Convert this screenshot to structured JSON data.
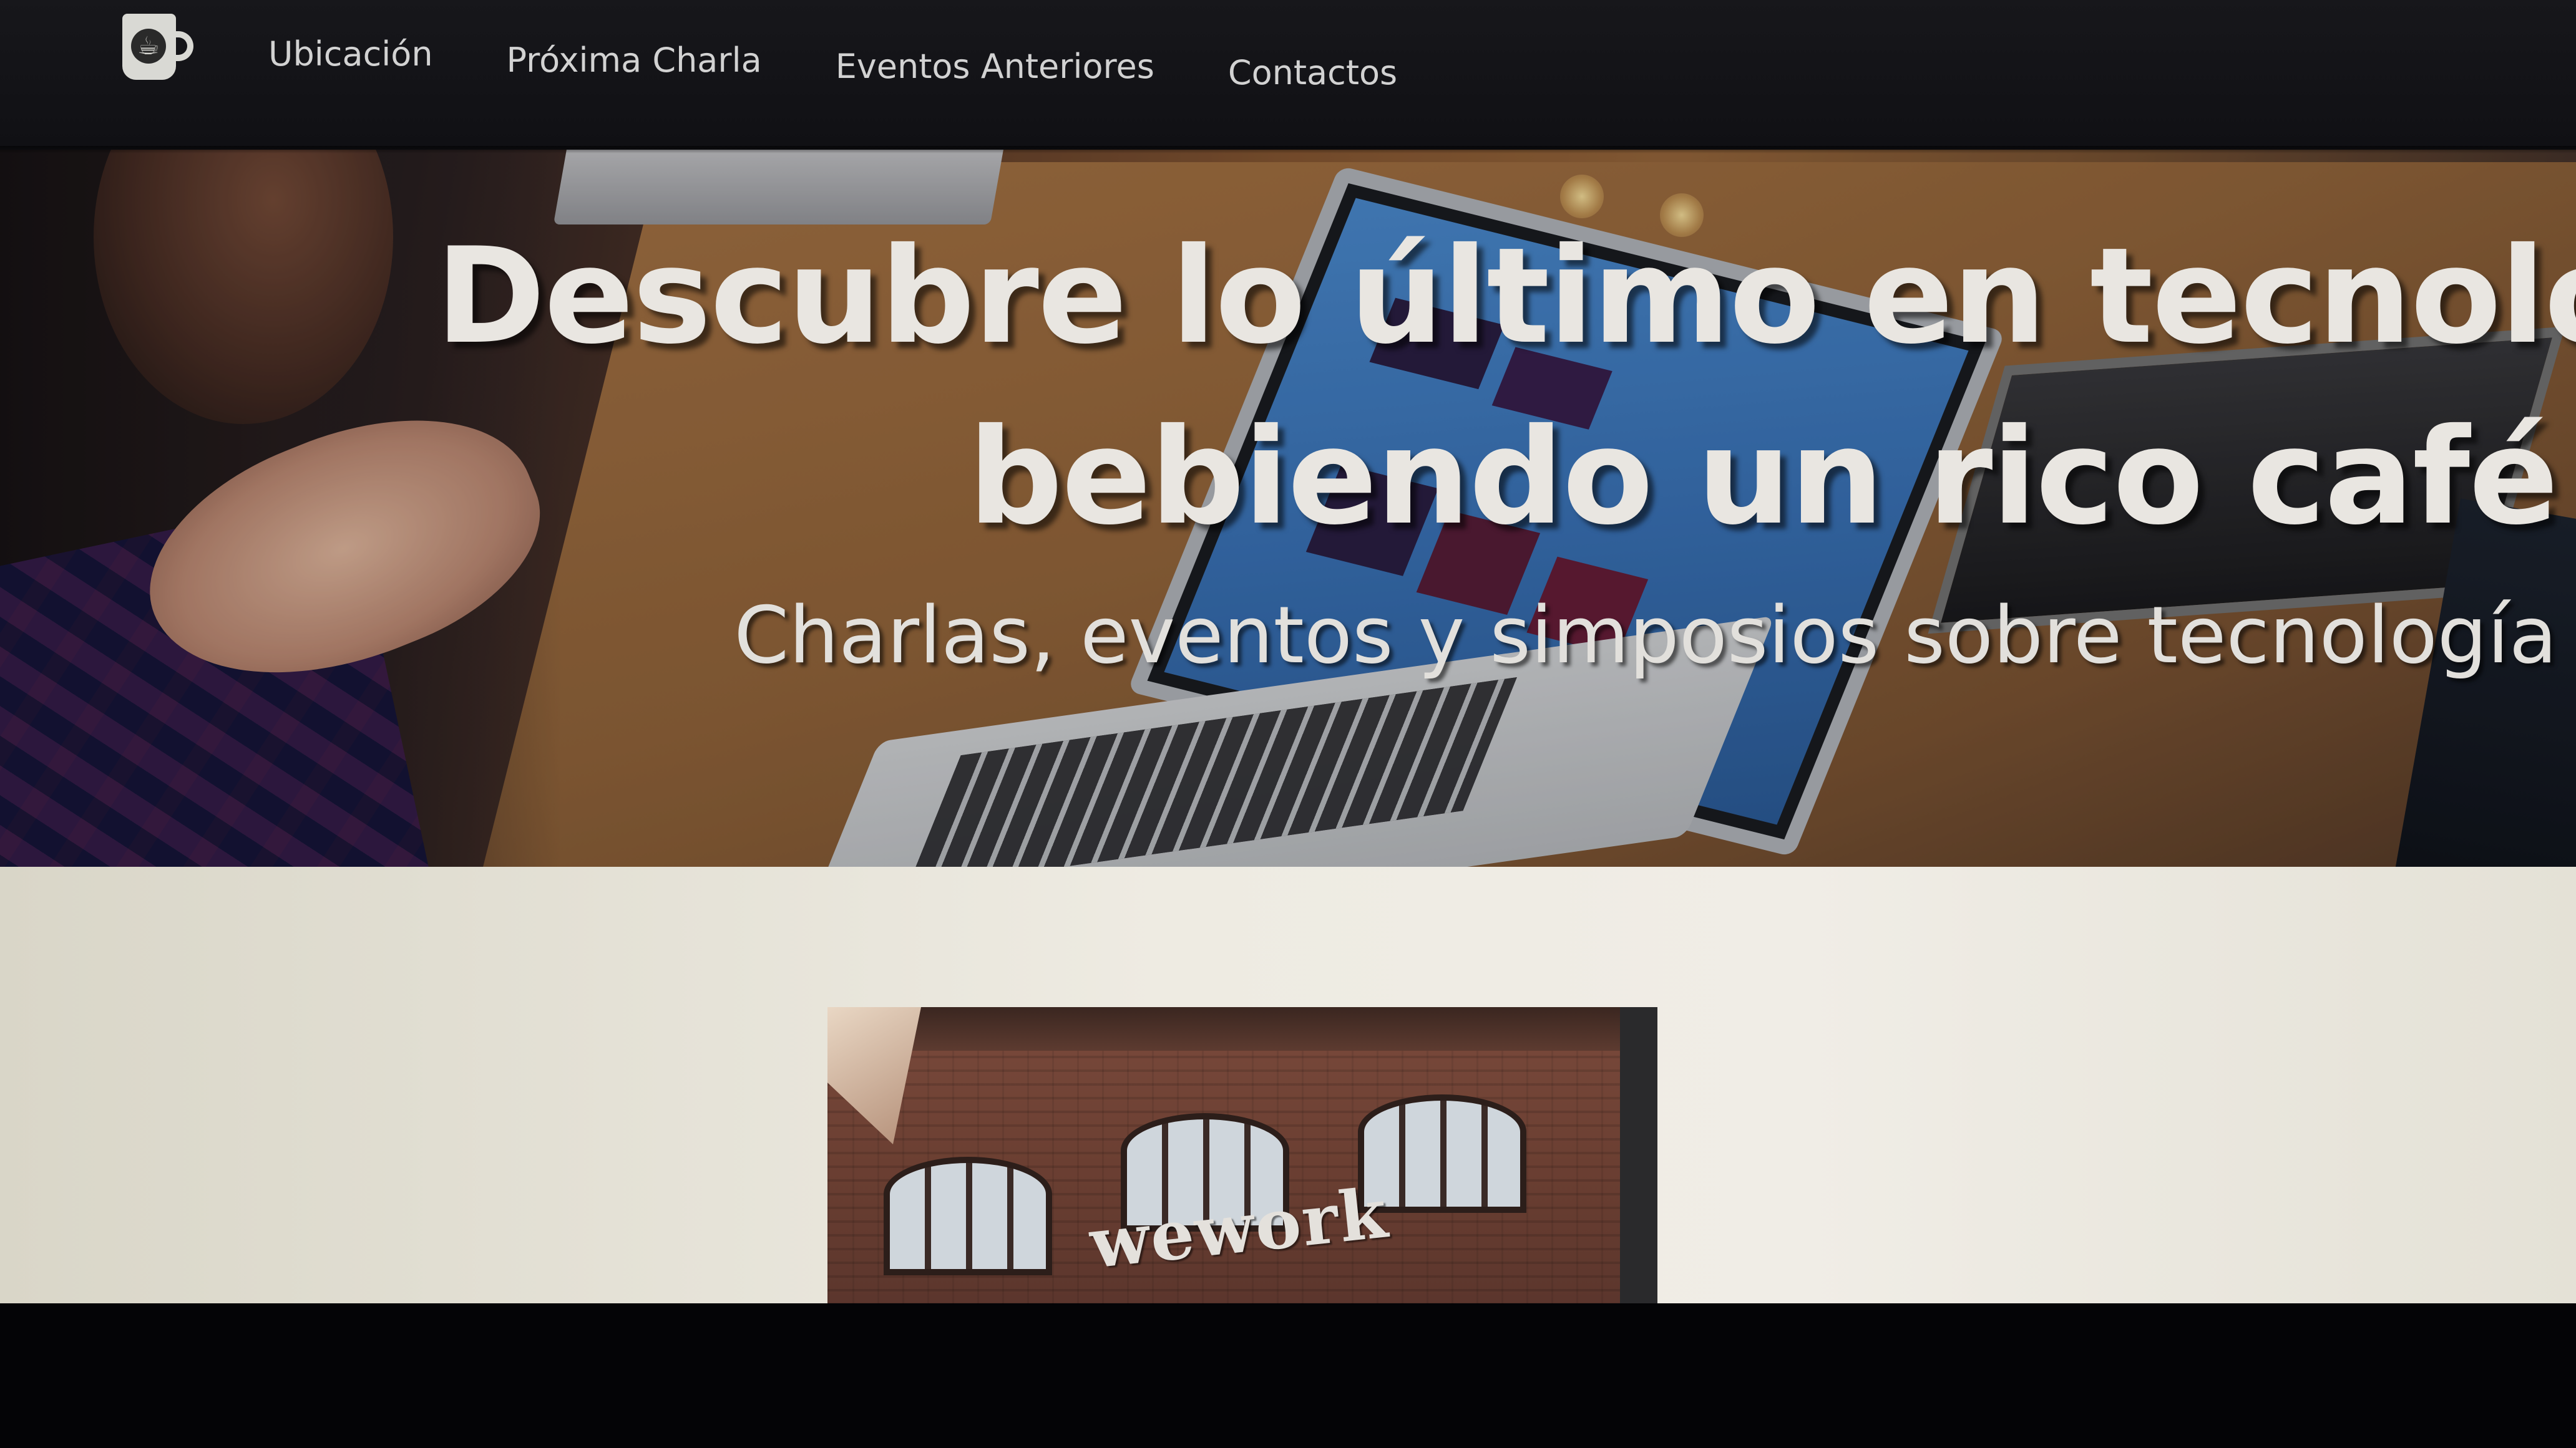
{
  "nav": {
    "logo_glyph": "☕",
    "items": [
      {
        "label": "Ubicación"
      },
      {
        "label": "Próxima Charla"
      },
      {
        "label": "Eventos Anteriores"
      },
      {
        "label": "Contactos"
      }
    ]
  },
  "hero": {
    "headline_line1": "Descubre lo último en tecnología",
    "headline_line2": "bebiendo un rico café",
    "subheadline": "Charlas, eventos y simposios sobre tecnología"
  },
  "venue": {
    "sign_text": "wework"
  },
  "colors": {
    "navbar_bg": "#131317",
    "nav_text": "#d2d2d2",
    "hero_text": "#e9e6e1",
    "page_bg": "#ebe8df"
  }
}
